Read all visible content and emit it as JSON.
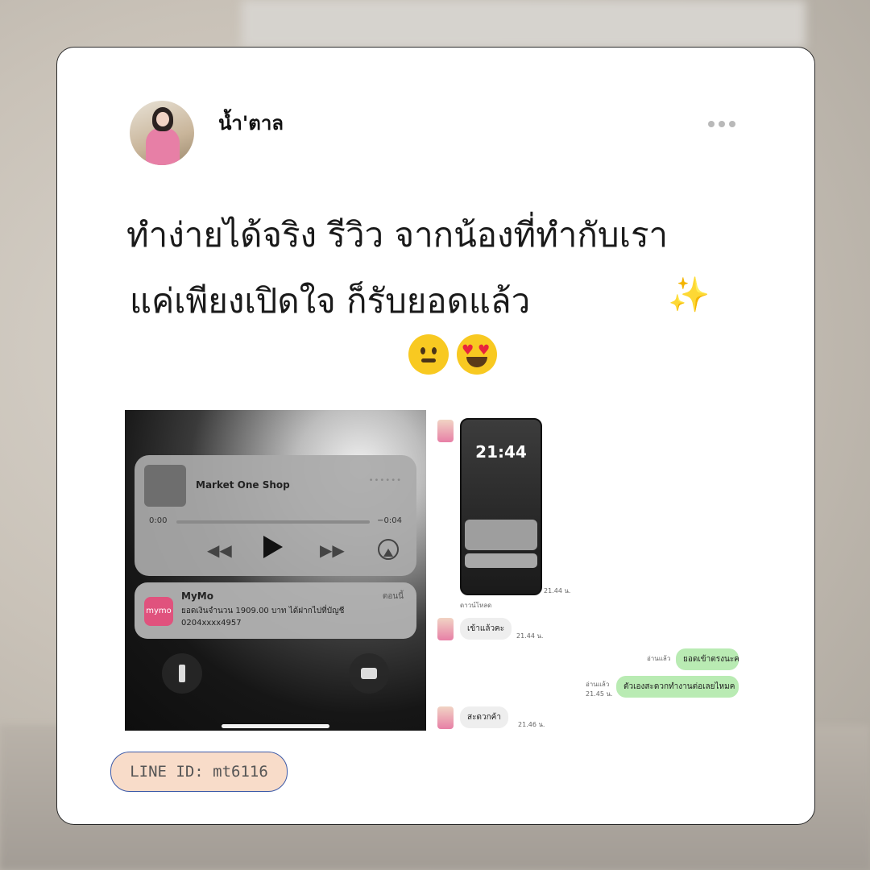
{
  "post": {
    "author": "น้ำ'ตาล",
    "text_line1": "ทำง่ายได้จริง รีวิว จากน้องที่ทำกับเรา",
    "text_line2": "แค่เพียงเปิดใจ ก็รับยอดแล้ว",
    "emojis": [
      "sparkles-icon",
      "grinning-face-icon",
      "heart-eyes-face-icon"
    ]
  },
  "screenshot": {
    "track_title": "Market One Shop",
    "time_elapsed": "0:00",
    "time_remaining": "−0:04",
    "notification": {
      "app_icon_text": "mymo",
      "app": "MyMo",
      "time": "ตอนนี้",
      "body": "ยอดเงินจำนวน 1909.00 บาท ได้ฝากไปที่บัญชี 0204xxxx4957"
    }
  },
  "chat": {
    "phone_clock": "21:44",
    "image_time": "21.44 น.",
    "download_label": "ดาวน์โหลด",
    "messages": [
      {
        "side": "left",
        "text": "เข้าแล้วคะ",
        "time": "21.44 น."
      },
      {
        "side": "right",
        "text": "ยอดเข้าตรงนะค",
        "status": "อ่านแล้ว",
        "time": ""
      },
      {
        "side": "right",
        "text": "ตัวเองสะดวกทำงานต่อเลยไหมค",
        "status": "อ่านแล้ว",
        "time": "21.45 น."
      },
      {
        "side": "left",
        "text": "สะดวกค้า",
        "time": "21.46 น."
      }
    ]
  },
  "line_id": "LINE ID: mt6116",
  "colors": {
    "card_bg": "#ffffff",
    "line_badge_bg": "#f8dcc9",
    "line_badge_border": "#3c5aa8",
    "bubble_right": "#b9ebb3",
    "bubble_left": "#eeeeee"
  }
}
